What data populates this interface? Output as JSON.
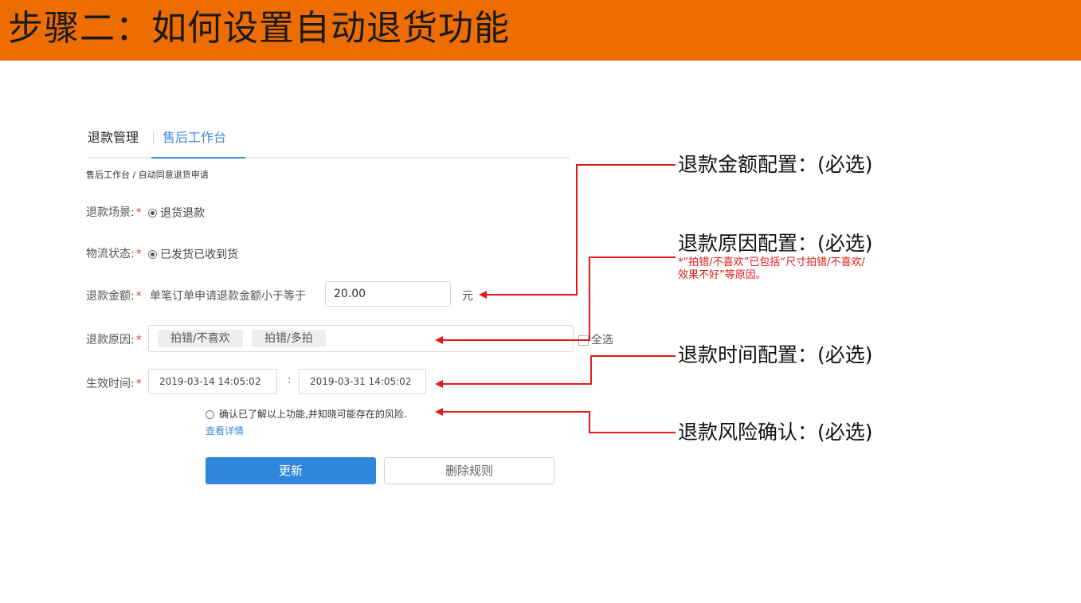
{
  "banner": {
    "title": "步骤二：如何设置自动退货功能"
  },
  "tabs": [
    {
      "label": "退款管理"
    },
    {
      "label": "售后工作台"
    }
  ],
  "breadcrumb": "售后工作台 / 自动同意退货申请",
  "form": {
    "scene": {
      "label": "退款场景:",
      "required": "*",
      "option": "退货退款"
    },
    "logistics": {
      "label": "物流状态:",
      "required": "*",
      "option": "已发货已收到货"
    },
    "amount": {
      "label": "退款金额:",
      "required": "*",
      "description": "单笔订单申请退款金额小于等于",
      "value": "20.00",
      "unit": "元"
    },
    "reason": {
      "label": "退款原因:",
      "required": "*",
      "tags": [
        "拍错/不喜欢",
        "拍错/多拍"
      ],
      "select_all": "全选"
    },
    "time": {
      "label": "生效时间:",
      "required": "*",
      "start": "2019-03-14 14:05:02",
      "separator": ":",
      "end": "2019-03-31 14:05:02"
    },
    "confirm": {
      "text": "确认已了解以上功能,并知晓可能存在的风险.",
      "details": "查看详情"
    },
    "buttons": {
      "update": "更新",
      "delete": "删除规则"
    }
  },
  "annotations": {
    "amount": "退款金额配置：(必选)",
    "reason": "退款原因配置：(必选)",
    "reason_note_1": "*“拍错/不喜欢”已包括“尺寸拍错/不喜欢/",
    "reason_note_2": "效果不好”等原因。",
    "time": "退款时间配置：(必选)",
    "risk": "退款风险确认：(必选)"
  },
  "colors": {
    "banner": "#ee6d02",
    "accent": "#2f87dc",
    "annotation_line": "#e41a1a"
  }
}
